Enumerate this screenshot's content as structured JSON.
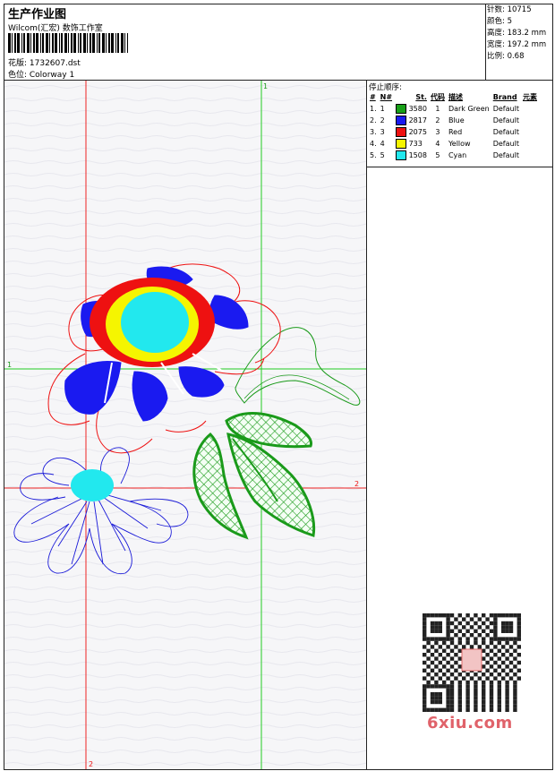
{
  "header": {
    "title": "生产作业图",
    "subtitle": "Wilcom(汇宏) 数饰工作室",
    "design_file": "花版: 1732607.dst",
    "colorway": "色位: Colorway 1"
  },
  "info": {
    "stitches": "针数: 10715",
    "colors": "颜色: 5",
    "height": "高度: 183.2 mm",
    "width": "宽度: 197.2 mm",
    "scale": "比例: 0.68"
  },
  "stop_sequence": {
    "title": "停止顺序:",
    "columns": [
      "#",
      "N#",
      "St.",
      "代码",
      "描述",
      "Brand",
      "元素"
    ],
    "rows": [
      {
        "n": "1.",
        "nn": "1",
        "color": "#18a018",
        "st": "3580",
        "code": "1",
        "desc": "Dark Green",
        "brand": "Default"
      },
      {
        "n": "2.",
        "nn": "2",
        "color": "#1a1af0",
        "st": "2817",
        "code": "2",
        "desc": "Blue",
        "brand": "Default"
      },
      {
        "n": "3.",
        "nn": "3",
        "color": "#ee1111",
        "st": "2075",
        "code": "3",
        "desc": "Red",
        "brand": "Default"
      },
      {
        "n": "4.",
        "nn": "4",
        "color": "#f5f500",
        "st": "733",
        "code": "4",
        "desc": "Yellow",
        "brand": "Default"
      },
      {
        "n": "5.",
        "nn": "5",
        "color": "#22e8ee",
        "st": "1508",
        "code": "5",
        "desc": "Cyan",
        "brand": "Default"
      }
    ]
  },
  "axes": {
    "v_green_label": "1",
    "h_green_label": "1",
    "h_red_label": "2",
    "v_red_label": "2"
  },
  "watermark": {
    "brand": "6xiu.com"
  }
}
